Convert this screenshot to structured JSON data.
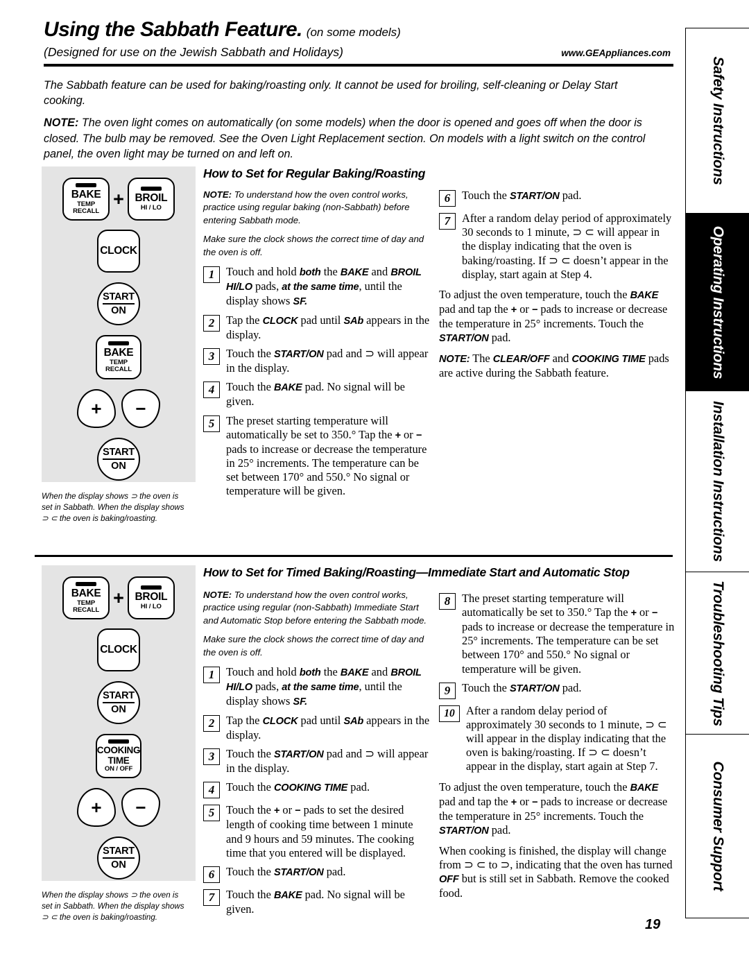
{
  "header": {
    "title": "Using the Sabbath Feature.",
    "title_sub": "(on some models)",
    "subtitle": "(Designed for use on the Jewish Sabbath and Holidays)",
    "website": "www.GEAppliances.com"
  },
  "intro": {
    "para1": "The Sabbath feature can be used for baking/roasting only. It cannot be used for broiling, self-cleaning or Delay Start cooking.",
    "note_label": "NOTE:",
    "note_text": " The oven light comes on automatically (on some models) when the door is opened and goes off when the door is closed. The bulb may be removed. See the Oven Light Replacement section. On models with a light switch on the control panel, the oven light may be turned on and left on."
  },
  "sidebar": {
    "tabs": [
      {
        "label": "Safety Instructions",
        "active": false
      },
      {
        "label": "Operating Instructions",
        "active": true
      },
      {
        "label": "Installation Instructions",
        "active": false
      },
      {
        "label": "Troubleshooting Tips",
        "active": false
      },
      {
        "label": "Consumer Support",
        "active": false
      }
    ]
  },
  "panel1": {
    "bake_main": "BAKE",
    "bake_sub1": "TEMP",
    "bake_sub2": "RECALL",
    "plus": "+",
    "broil_main": "BROIL",
    "broil_sub": "HI / LO",
    "clock": "CLOCK",
    "start_top": "START",
    "start_bot": "ON",
    "bake2_main": "BAKE",
    "bake2_sub1": "TEMP",
    "bake2_sub2": "RECALL",
    "plus_pad": "+",
    "minus_pad": "−",
    "start2_top": "START",
    "start2_bot": "ON",
    "caption": "When the display shows ⊃ the oven is set in Sabbath. When the display shows ⊃ ⊂ the oven is baking/roasting."
  },
  "panel2": {
    "bake_main": "BAKE",
    "bake_sub1": "TEMP",
    "bake_sub2": "RECALL",
    "plus": "+",
    "broil_main": "BROIL",
    "broil_sub": "HI / LO",
    "clock": "CLOCK",
    "start_top": "START",
    "start_bot": "ON",
    "cook_main1": "COOKING",
    "cook_main2": "TIME",
    "cook_sub": "ON / OFF",
    "plus_pad": "+",
    "minus_pad": "−",
    "start2_top": "START",
    "start2_bot": "ON",
    "caption": "When the display shows ⊃ the oven is set in Sabbath. When the display shows ⊃ ⊂ the oven is baking/roasting."
  },
  "section1": {
    "heading": "How to Set for Regular Baking/Roasting",
    "note_label": "NOTE:",
    "note_text": " To understand how the oven control works, practice using regular baking (non-Sabbath) before entering Sabbath mode.",
    "note2": "Make sure the clock shows the correct time of day and the oven is off.",
    "steps_left": [
      {
        "num": "1",
        "text_parts": [
          {
            "t": "Touch and hold ",
            "s": "n"
          },
          {
            "t": "both",
            "s": "bi"
          },
          {
            "t": " the ",
            "s": "n"
          },
          {
            "t": "BAKE",
            "s": "bi"
          },
          {
            "t": " and ",
            "s": "n"
          },
          {
            "t": "BROIL HI/LO",
            "s": "bi"
          },
          {
            "t": " pads, ",
            "s": "n"
          },
          {
            "t": "at the same time",
            "s": "bi"
          },
          {
            "t": ", until the display shows ",
            "s": "n"
          },
          {
            "t": "SF.",
            "s": "bi"
          }
        ]
      },
      {
        "num": "2",
        "text_parts": [
          {
            "t": "Tap the ",
            "s": "n"
          },
          {
            "t": "CLOCK",
            "s": "bi"
          },
          {
            "t": " pad until ",
            "s": "n"
          },
          {
            "t": "SAb",
            "s": "bi"
          },
          {
            "t": " appears in the display.",
            "s": "n"
          }
        ]
      },
      {
        "num": "3",
        "text_parts": [
          {
            "t": "Touch the ",
            "s": "n"
          },
          {
            "t": "START/ON",
            "s": "bi"
          },
          {
            "t": " pad and ⊃ will appear in the display.",
            "s": "n"
          }
        ]
      },
      {
        "num": "4",
        "text_parts": [
          {
            "t": "Touch the ",
            "s": "n"
          },
          {
            "t": "BAKE",
            "s": "bi"
          },
          {
            "t": " pad. No signal will be given.",
            "s": "n"
          }
        ]
      },
      {
        "num": "5",
        "text_parts": [
          {
            "t": "The preset starting temperature will automatically be set to 350.° Tap the ",
            "s": "n"
          },
          {
            "t": "+",
            "s": "bn"
          },
          {
            "t": " or ",
            "s": "n"
          },
          {
            "t": "−",
            "s": "bn"
          },
          {
            "t": " pads to increase or decrease the temperature in 25° increments. The temperature can be set between 170° and 550.° No signal or temperature will be given.",
            "s": "n"
          }
        ]
      }
    ],
    "steps_right": [
      {
        "num": "6",
        "text_parts": [
          {
            "t": "Touch the ",
            "s": "n"
          },
          {
            "t": "START/ON",
            "s": "bi"
          },
          {
            "t": " pad.",
            "s": "n"
          }
        ]
      },
      {
        "num": "7",
        "text_parts": [
          {
            "t": "After a random delay period of approximately 30 seconds to 1 minute, ⊃ ⊂ will appear in the display indicating that the oven is baking/roasting. If ⊃ ⊂ doesn’t appear in the display, start again at Step 4.",
            "s": "n"
          }
        ]
      }
    ],
    "closing1_parts": [
      {
        "t": "To adjust the oven temperature, touch the ",
        "s": "n"
      },
      {
        "t": "BAKE",
        "s": "bi"
      },
      {
        "t": " pad and tap the ",
        "s": "n"
      },
      {
        "t": "+",
        "s": "bn"
      },
      {
        "t": " or ",
        "s": "n"
      },
      {
        "t": "−",
        "s": "bn"
      },
      {
        "t": " pads to increase or decrease the temperature in 25° increments. Touch the ",
        "s": "n"
      },
      {
        "t": "START/ON",
        "s": "bi"
      },
      {
        "t": " pad.",
        "s": "n"
      }
    ],
    "closing2_parts": [
      {
        "t": "NOTE:",
        "s": "bi"
      },
      {
        "t": " The ",
        "s": "n"
      },
      {
        "t": "CLEAR/OFF",
        "s": "bi"
      },
      {
        "t": " and ",
        "s": "n"
      },
      {
        "t": "COOKING TIME",
        "s": "bi"
      },
      {
        "t": " pads are active during the Sabbath feature.",
        "s": "n"
      }
    ]
  },
  "section2": {
    "heading": "How to Set for Timed Baking/Roasting—Immediate Start and Automatic Stop",
    "note_label": "NOTE:",
    "note_text": " To understand how the oven control works, practice using regular (non-Sabbath) Immediate Start and Automatic Stop before entering the Sabbath mode.",
    "note2": "Make sure the clock shows the correct time of day and the oven is off.",
    "steps_left": [
      {
        "num": "1",
        "text_parts": [
          {
            "t": "Touch and hold ",
            "s": "n"
          },
          {
            "t": "both",
            "s": "bi"
          },
          {
            "t": " the ",
            "s": "n"
          },
          {
            "t": "BAKE",
            "s": "bi"
          },
          {
            "t": " and ",
            "s": "n"
          },
          {
            "t": "BROIL HI/LO",
            "s": "bi"
          },
          {
            "t": " pads, ",
            "s": "n"
          },
          {
            "t": "at the same time",
            "s": "bi"
          },
          {
            "t": ", until the display shows ",
            "s": "n"
          },
          {
            "t": "SF.",
            "s": "bi"
          }
        ]
      },
      {
        "num": "2",
        "text_parts": [
          {
            "t": "Tap the ",
            "s": "n"
          },
          {
            "t": "CLOCK",
            "s": "bi"
          },
          {
            "t": " pad until ",
            "s": "n"
          },
          {
            "t": "SAb",
            "s": "bi"
          },
          {
            "t": " appears in the display.",
            "s": "n"
          }
        ]
      },
      {
        "num": "3",
        "text_parts": [
          {
            "t": "Touch the ",
            "s": "n"
          },
          {
            "t": "START/ON",
            "s": "bi"
          },
          {
            "t": " pad and ⊃ will appear in the display.",
            "s": "n"
          }
        ]
      },
      {
        "num": "4",
        "text_parts": [
          {
            "t": "Touch the ",
            "s": "n"
          },
          {
            "t": "COOKING TIME",
            "s": "bi"
          },
          {
            "t": " pad.",
            "s": "n"
          }
        ]
      },
      {
        "num": "5",
        "text_parts": [
          {
            "t": "Touch the ",
            "s": "n"
          },
          {
            "t": "+",
            "s": "bn"
          },
          {
            "t": " or ",
            "s": "n"
          },
          {
            "t": "−",
            "s": "bn"
          },
          {
            "t": " pads to set the desired length of cooking time between 1 minute and 9 hours and 59 minutes. The cooking time that you entered will be displayed.",
            "s": "n"
          }
        ]
      },
      {
        "num": "6",
        "text_parts": [
          {
            "t": "Touch the ",
            "s": "n"
          },
          {
            "t": "START/ON",
            "s": "bi"
          },
          {
            "t": " pad.",
            "s": "n"
          }
        ]
      },
      {
        "num": "7",
        "text_parts": [
          {
            "t": "Touch the ",
            "s": "n"
          },
          {
            "t": "BAKE",
            "s": "bi"
          },
          {
            "t": " pad. No signal will be given.",
            "s": "n"
          }
        ]
      }
    ],
    "steps_right": [
      {
        "num": "8",
        "text_parts": [
          {
            "t": "The preset starting temperature will automatically be set to 350.° Tap the ",
            "s": "n"
          },
          {
            "t": "+",
            "s": "bn"
          },
          {
            "t": " or ",
            "s": "n"
          },
          {
            "t": "−",
            "s": "bn"
          },
          {
            "t": " pads to increase or decrease the temperature in 25° increments. The temperature can be set between 170° and 550.° No signal or temperature will be given.",
            "s": "n"
          }
        ]
      },
      {
        "num": "9",
        "text_parts": [
          {
            "t": "Touch the ",
            "s": "n"
          },
          {
            "t": "START/ON",
            "s": "bi"
          },
          {
            "t": " pad.",
            "s": "n"
          }
        ]
      },
      {
        "num": "10",
        "text_parts": [
          {
            "t": "After a random delay period of approximately 30 seconds to 1 minute, ⊃ ⊂ will appear in the display indicating that the oven is baking/roasting. If ⊃ ⊂ doesn’t appear in the display, start again at Step 7.",
            "s": "n"
          }
        ]
      }
    ],
    "closing1_parts": [
      {
        "t": "To adjust the oven temperature, touch the ",
        "s": "n"
      },
      {
        "t": "BAKE",
        "s": "bi"
      },
      {
        "t": " pad and tap the ",
        "s": "n"
      },
      {
        "t": "+",
        "s": "bn"
      },
      {
        "t": " or ",
        "s": "n"
      },
      {
        "t": "−",
        "s": "bn"
      },
      {
        "t": " pads to increase or decrease the temperature in 25° increments. Touch the ",
        "s": "n"
      },
      {
        "t": "START/ON",
        "s": "bi"
      },
      {
        "t": " pad.",
        "s": "n"
      }
    ],
    "closing2_parts": [
      {
        "t": "When cooking is finished, the display will change from ⊃ ⊂ to ⊃, indicating that the oven has turned ",
        "s": "n"
      },
      {
        "t": "OFF",
        "s": "bi"
      },
      {
        "t": " but is still set in Sabbath. Remove the cooked food.",
        "s": "n"
      }
    ]
  },
  "page_number": "19"
}
